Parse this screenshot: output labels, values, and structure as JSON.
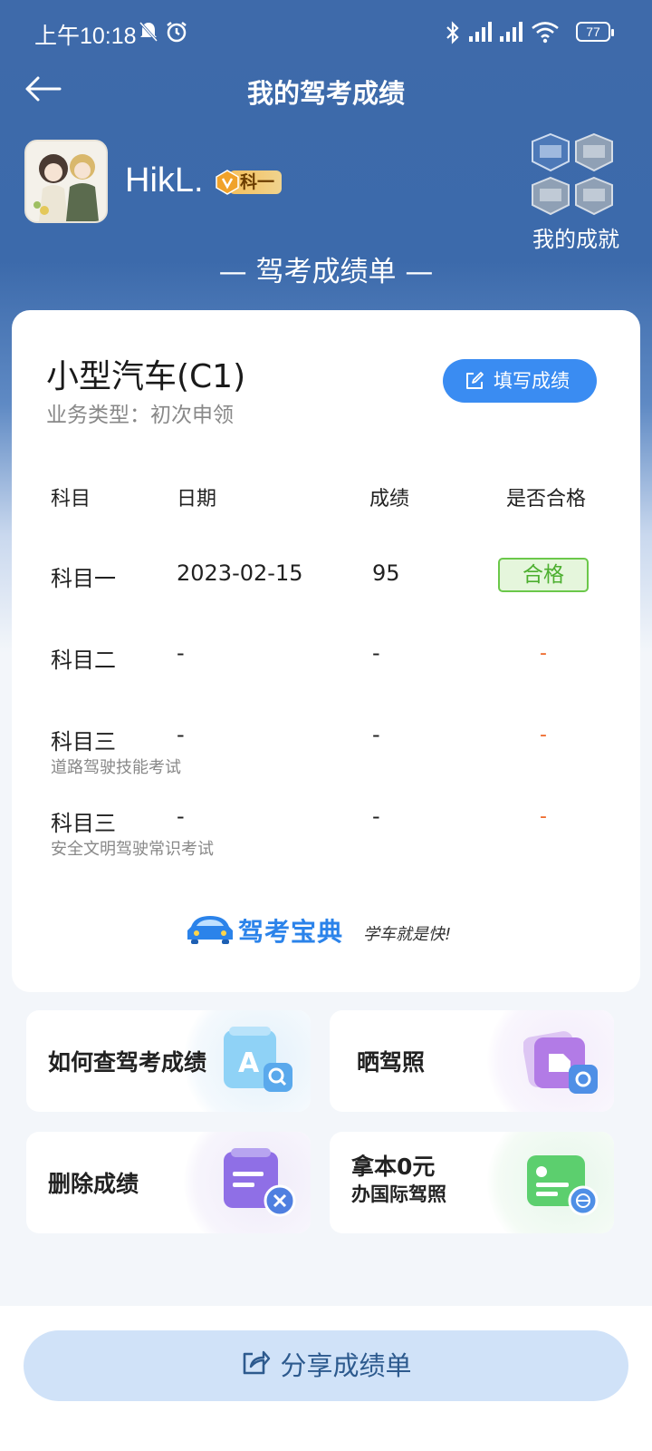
{
  "status_bar": {
    "time": "上午10:18",
    "battery": "77"
  },
  "nav": {
    "title": "我的驾考成绩"
  },
  "profile": {
    "username": "HikL.",
    "level_badge": "科一",
    "achievements_label": "我的成就"
  },
  "sheet_title": "— 驾考成绩单 —",
  "card": {
    "vehicle_type": "小型汽车(C1)",
    "business_type": "业务类型：初次申领",
    "fill_button": "填写成绩",
    "headers": [
      "科目",
      "日期",
      "成绩",
      "是否合格"
    ],
    "rows": [
      {
        "subject": "科目一",
        "sub": "",
        "date": "2023-02-15",
        "score": "95",
        "pass": "合格"
      },
      {
        "subject": "科目二",
        "sub": "",
        "date": "-",
        "score": "-",
        "pass": "-"
      },
      {
        "subject": "科目三",
        "sub": "道路驾驶技能考试",
        "date": "-",
        "score": "-",
        "pass": "-"
      },
      {
        "subject": "科目三",
        "sub": "安全文明驾驶常识考试",
        "date": "-",
        "score": "-",
        "pass": "-"
      }
    ],
    "brand": {
      "name": "驾考宝典",
      "slogan": "学车就是快!"
    }
  },
  "tiles": [
    {
      "label": "如何查驾考成绩",
      "icon": "document-search-icon"
    },
    {
      "label": "晒驾照",
      "icon": "photo-share-icon"
    },
    {
      "label": "删除成绩",
      "icon": "delete-record-icon"
    },
    {
      "label_line1": "拿本0元",
      "label_line2": "办国际驾照",
      "icon": "international-license-icon"
    }
  ],
  "share_button": "分享成绩单",
  "colors": {
    "header_blue": "#3e6aaa",
    "button_blue": "#3a8cf2",
    "pass_green": "#4caf2f",
    "dash_orange": "#ee6a2c",
    "share_bg": "#d0e2f8"
  }
}
